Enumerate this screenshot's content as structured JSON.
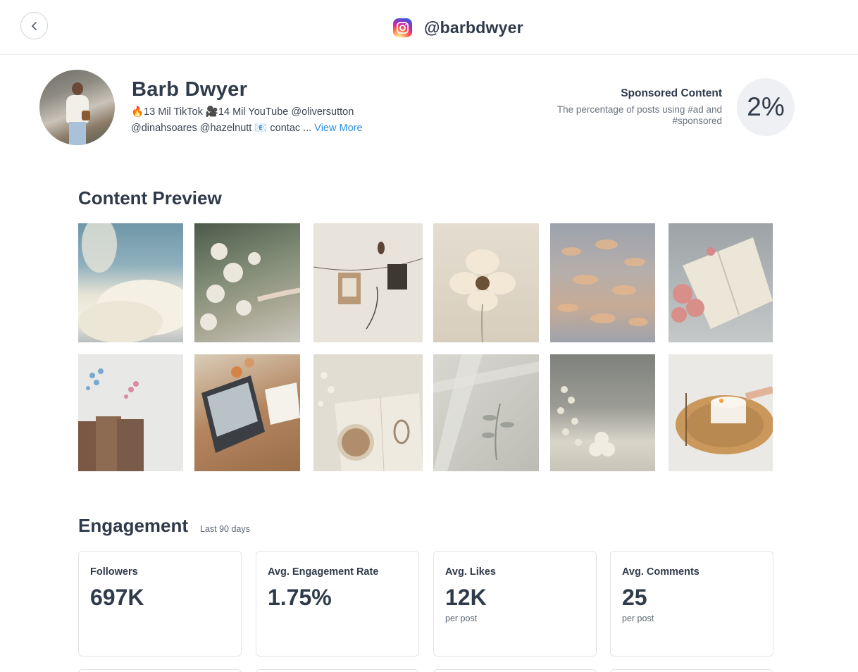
{
  "header": {
    "handle": "@barbdwyer",
    "platform_icon": "instagram-icon",
    "back_icon": "chevron-left-icon"
  },
  "profile": {
    "name": "Barb Dwyer",
    "bio_line1": "🔥13 Mil TikTok 🎥14 Mil YouTube @oliversutton",
    "bio_line2": "@dinahsoares @hazelnutt 📧 contac ...",
    "view_more": "View More"
  },
  "sponsored": {
    "title": "Sponsored Content",
    "description": "The percentage of posts using #ad and #sponsored",
    "value": "2%"
  },
  "content_preview": {
    "title": "Content Preview",
    "images": [
      "cloud-sky-photo",
      "white-flowers-hand-photo",
      "hanging-photos-string-photo",
      "cream-cosmos-flower-photo",
      "sunset-clouds-photo",
      "open-book-pink-flowers-photo",
      "old-books-dried-flowers-photo",
      "laptop-desk-photo",
      "coffee-book-flatlay-photo",
      "plant-shadow-wall-photo",
      "babys-breath-bubble-candle-photo",
      "lighting-candle-photo"
    ]
  },
  "engagement": {
    "title": "Engagement",
    "period": "Last 90 days",
    "cards": [
      {
        "label": "Followers",
        "value": "697K",
        "unit": ""
      },
      {
        "label": "Avg. Engagement Rate",
        "value": "1.75%",
        "unit": ""
      },
      {
        "label": "Avg. Likes",
        "value": "12K",
        "unit": "per post"
      },
      {
        "label": "Avg. Comments",
        "value": "25",
        "unit": "per post"
      }
    ]
  },
  "colors": {
    "text": "#2f3a4a",
    "link": "#2e8fe0",
    "border": "#e1e4e8"
  }
}
